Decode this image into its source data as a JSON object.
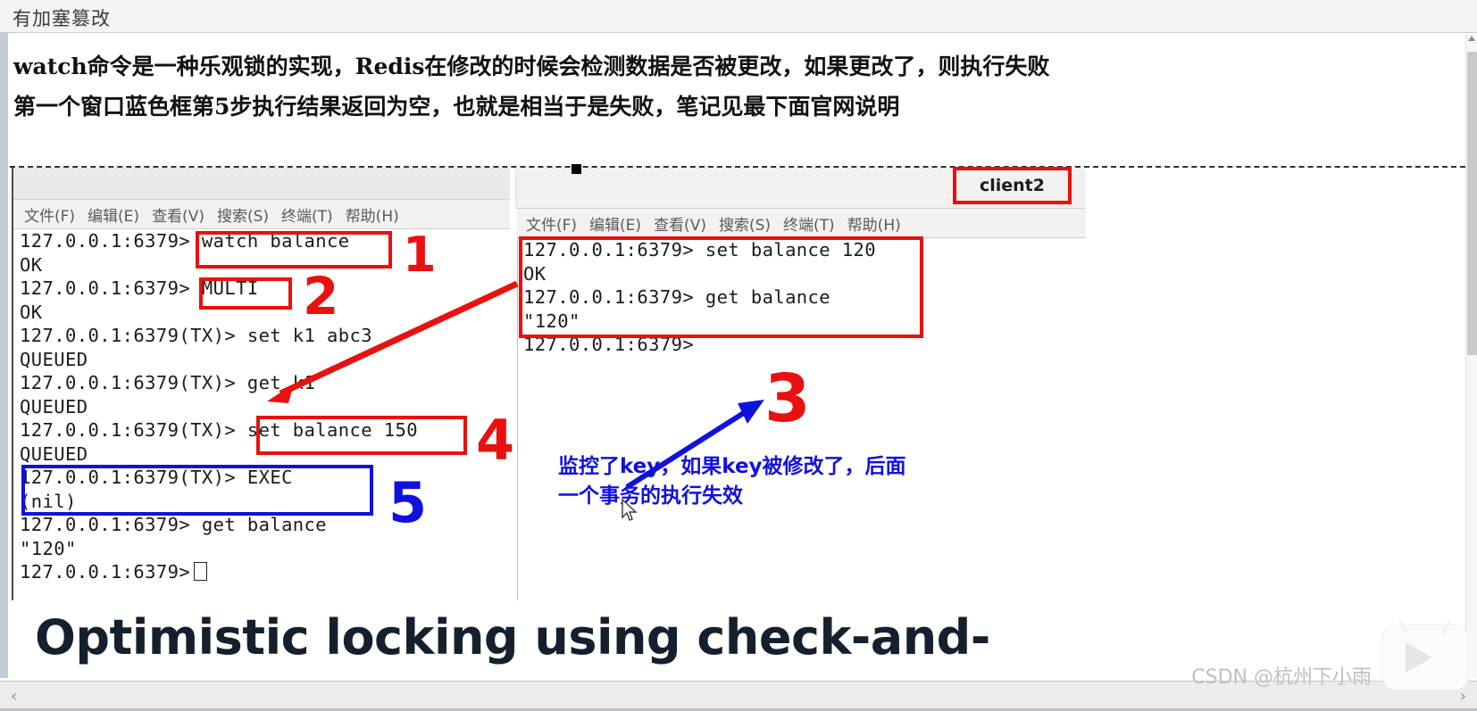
{
  "window": {
    "breadcrumb_title": "有加塞篡改"
  },
  "heading": {
    "line1": "watch命令是一种乐观锁的实现，Redis在修改的时候会检测数据是否被更改，如果更改了，则执行失败",
    "line2": "第一个窗口蓝色框第5步执行结果返回为空，也就是相当于是失败，笔记见最下面官网说明"
  },
  "terminal1": {
    "menu": [
      "文件(F)",
      "编辑(E)",
      "查看(V)",
      "搜索(S)",
      "终端(T)",
      "帮助(H)"
    ],
    "lines": [
      "127.0.0.1:6379> watch balance",
      "OK",
      "127.0.0.1:6379> MULTI",
      "OK",
      "127.0.0.1:6379(TX)> set k1 abc3",
      "QUEUED",
      "127.0.0.1:6379(TX)> get k1",
      "QUEUED",
      "127.0.0.1:6379(TX)> set balance 150",
      "QUEUED",
      "127.0.0.1:6379(TX)> EXEC",
      "(nil)",
      "127.0.0.1:6379> get balance",
      "\"120\""
    ],
    "prompt_last": "127.0.0.1:6379>"
  },
  "terminal2": {
    "tab_label": "client2",
    "menu": [
      "文件(F)",
      "编辑(E)",
      "查看(V)",
      "搜索(S)",
      "终端(T)",
      "帮助(H)"
    ],
    "lines": [
      "127.0.0.1:6379> set balance 120",
      "OK",
      "127.0.0.1:6379> get balance",
      "\"120\"",
      "127.0.0.1:6379>"
    ]
  },
  "annotations": {
    "numerals": {
      "one": "1",
      "two": "2",
      "three": "3",
      "four": "4",
      "five": "5"
    },
    "note_blue_line1": "监控了key，如果key被修改了，后面",
    "note_blue_line2": "一个事务的执行失效",
    "colors": {
      "red": "#e8110f",
      "blue": "#1111dd"
    }
  },
  "bottom": {
    "big_heading": "Optimistic locking using check-and-"
  },
  "scrollbars": {
    "left_arrow": "‹",
    "right_arrow": "›"
  },
  "watermark": {
    "text": "CSDN @杭州下小雨"
  }
}
